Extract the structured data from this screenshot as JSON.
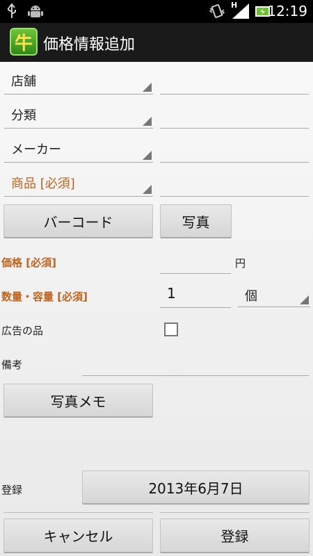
{
  "status_bar": {
    "icons": [
      "usb-icon",
      "android-debug-icon",
      "vibrate-icon",
      "signal-icon",
      "battery-charging-icon"
    ],
    "network": "H",
    "time": "12:19"
  },
  "action_bar": {
    "app_icon_glyph": "牛",
    "title": "価格情報追加"
  },
  "form": {
    "store": {
      "label": "店舗",
      "value": ""
    },
    "category": {
      "label": "分類",
      "value": ""
    },
    "maker": {
      "label": "メーカー",
      "value": ""
    },
    "product": {
      "label": "商品 [必須]",
      "value": ""
    },
    "barcode_button": "バーコード",
    "photo_button": "写真",
    "price": {
      "label": "価格 [必須]",
      "value": "",
      "unit": "円"
    },
    "quantity": {
      "label": "数量・容量 [必須]",
      "value": "1",
      "unit": "個"
    },
    "advert": {
      "label": "広告の品",
      "checked": false
    },
    "notes": {
      "label": "備考",
      "value": ""
    },
    "photo_memo_button": "写真メモ",
    "registered": {
      "label": "登録",
      "date": "2013年6月7日"
    }
  },
  "footer": {
    "cancel": "キャンセル",
    "register": "登録"
  },
  "colors": {
    "required_label": "#c0621b",
    "status_bar": "#000000",
    "action_bar": "#1a1a1a"
  }
}
